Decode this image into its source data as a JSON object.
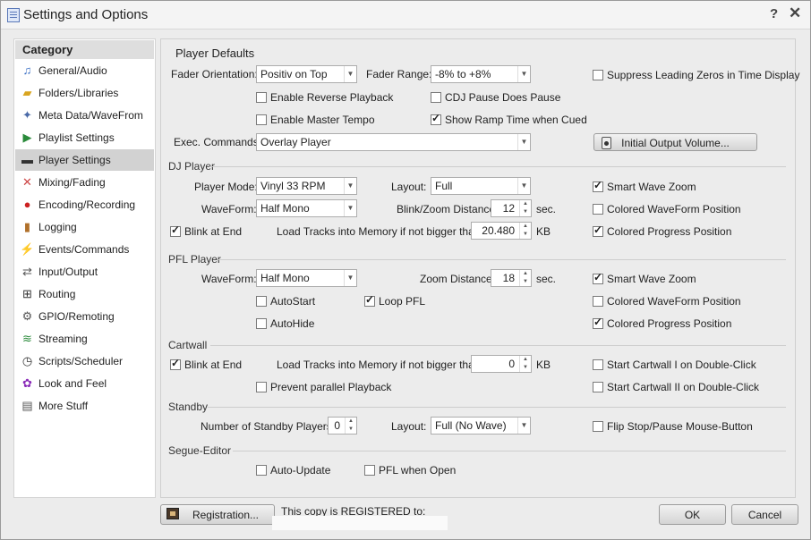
{
  "window": {
    "title": "Settings and Options",
    "help": "?",
    "close": "✕"
  },
  "sidebar": {
    "header": "Category",
    "items": [
      {
        "label": "General/Audio",
        "icon": "music-note-icon",
        "glyph": "♫",
        "color": "#3a6fc4"
      },
      {
        "label": "Folders/Libraries",
        "icon": "folder-icon",
        "glyph": "▰",
        "color": "#d9a520"
      },
      {
        "label": "Meta Data/WaveFrom",
        "icon": "metadata-icon",
        "glyph": "✦",
        "color": "#4a6aa8"
      },
      {
        "label": "Playlist Settings",
        "icon": "playlist-icon",
        "glyph": "▶",
        "color": "#2a8a3a"
      },
      {
        "label": "Player Settings",
        "icon": "player-icon",
        "glyph": "▬",
        "color": "#333333"
      },
      {
        "label": "Mixing/Fading",
        "icon": "crossfade-icon",
        "glyph": "✕",
        "color": "#cc4444"
      },
      {
        "label": "Encoding/Recording",
        "icon": "record-icon",
        "glyph": "●",
        "color": "#cc2222"
      },
      {
        "label": "Logging",
        "icon": "log-icon",
        "glyph": "▮",
        "color": "#b0702a"
      },
      {
        "label": "Events/Commands",
        "icon": "lightning-icon",
        "glyph": "⚡",
        "color": "#d6a400"
      },
      {
        "label": "Input/Output",
        "icon": "io-icon",
        "glyph": "⇄",
        "color": "#555555"
      },
      {
        "label": "Routing",
        "icon": "routing-icon",
        "glyph": "⊞",
        "color": "#333333"
      },
      {
        "label": "GPIO/Remoting",
        "icon": "gpio-icon",
        "glyph": "⚙",
        "color": "#555555"
      },
      {
        "label": "Streaming",
        "icon": "streaming-icon",
        "glyph": "≋",
        "color": "#2a8a3a"
      },
      {
        "label": "Scripts/Scheduler",
        "icon": "clock-icon",
        "glyph": "◷",
        "color": "#333333"
      },
      {
        "label": "Look and Feel",
        "icon": "palette-icon",
        "glyph": "✿",
        "color": "#8a2ab8"
      },
      {
        "label": "More Stuff",
        "icon": "more-stuff-icon",
        "glyph": "▤",
        "color": "#555555"
      }
    ],
    "selected": "Player Settings"
  },
  "player_defaults": {
    "title": "Player Defaults",
    "fader_orientation_label": "Fader Orientation:",
    "fader_orientation_value": "Positiv on Top",
    "fader_range_label": "Fader Range:",
    "fader_range_value": "-8% to  +8%",
    "suppress_zeros": {
      "label": "Suppress Leading Zeros in Time Display",
      "checked": false
    },
    "reverse_playback": {
      "label": "Enable Reverse Playback",
      "checked": false
    },
    "cdj_pause": {
      "label": "CDJ Pause Does Pause",
      "checked": false
    },
    "master_tempo": {
      "label": "Enable Master Tempo",
      "checked": false
    },
    "ramp_time": {
      "label": "Show Ramp Time when Cued",
      "checked": true
    },
    "exec_label": "Exec. Commands:",
    "exec_value": "Overlay Player",
    "initial_volume_button": "Initial Output Volume..."
  },
  "dj_player": {
    "title": "DJ Player",
    "player_mode_label": "Player Mode:",
    "player_mode_value": "Vinyl 33 RPM",
    "layout_label": "Layout:",
    "layout_value": "Full",
    "smart_wave_zoom": {
      "label": "Smart Wave Zoom",
      "checked": true
    },
    "waveform_label": "WaveForm:",
    "waveform_value": "Half Mono",
    "blink_zoom_label": "Blink/Zoom Distance:",
    "blink_zoom_value": "12",
    "blink_zoom_unit": "sec.",
    "colored_waveform": {
      "label": "Colored WaveForm Position",
      "checked": false
    },
    "blink_at_end": {
      "label": "Blink at End",
      "checked": true
    },
    "load_label": "Load Tracks into Memory if not bigger than:",
    "load_value": "20.480",
    "load_unit": "KB",
    "colored_progress": {
      "label": "Colored Progress Position",
      "checked": true
    }
  },
  "pfl_player": {
    "title": "PFL Player",
    "waveform_label": "WaveForm:",
    "waveform_value": "Half Mono",
    "zoom_label": "Zoom Distance:",
    "zoom_value": "18",
    "zoom_unit": "sec.",
    "smart_wave_zoom": {
      "label": "Smart Wave Zoom",
      "checked": true
    },
    "autostart": {
      "label": "AutoStart",
      "checked": false
    },
    "loop_pfl": {
      "label": "Loop PFL",
      "checked": true
    },
    "colored_waveform": {
      "label": "Colored WaveForm Position",
      "checked": false
    },
    "autohide": {
      "label": "AutoHide",
      "checked": false
    },
    "colored_progress": {
      "label": "Colored Progress Position",
      "checked": true
    }
  },
  "cartwall": {
    "title": "Cartwall",
    "blink_at_end": {
      "label": "Blink at End",
      "checked": true
    },
    "load_label": "Load Tracks into Memory if not bigger than:",
    "load_value": "0",
    "load_unit": "KB",
    "start_cartwall_1": {
      "label": "Start Cartwall I on Double-Click",
      "checked": false
    },
    "prevent_parallel": {
      "label": "Prevent parallel Playback",
      "checked": false
    },
    "start_cartwall_2": {
      "label": "Start Cartwall II on Double-Click",
      "checked": false
    }
  },
  "standby": {
    "title": "Standby",
    "players_label": "Number of Standby Players:",
    "players_value": "0",
    "layout_label": "Layout:",
    "layout_value": "Full (No Wave)",
    "flip_stop": {
      "label": "Flip Stop/Pause Mouse-Button",
      "checked": false
    }
  },
  "segue_editor": {
    "title": "Segue-Editor",
    "auto_update": {
      "label": "Auto-Update",
      "checked": false
    },
    "pfl_when_open": {
      "label": "PFL when Open",
      "checked": false
    }
  },
  "footer": {
    "registration_button": "Registration...",
    "registered_text": "This copy is REGISTERED to:",
    "ok": "OK",
    "cancel": "Cancel"
  }
}
